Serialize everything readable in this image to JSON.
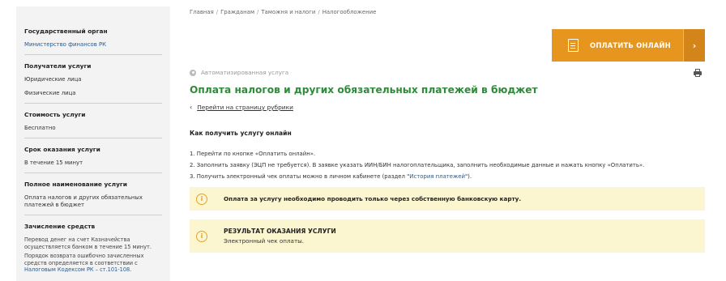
{
  "sidebar": {
    "agency": {
      "heading": "Государственный орган",
      "value": "Министерство финансов РК"
    },
    "recipients": {
      "heading": "Получатели услуги",
      "items": [
        "Юридические лица",
        "Физические лица"
      ]
    },
    "cost": {
      "heading": "Стоимость услуги",
      "value": "Бесплатно"
    },
    "duration": {
      "heading": "Срок оказания услуги",
      "value": "В течение 15 минут"
    },
    "full_name": {
      "heading": "Полное наименование услуги",
      "line1": "Оплата налогов и других обязательных",
      "line2": "платежей в бюджет"
    },
    "crediting": {
      "heading": "Зачисление средств",
      "p1_line1": "Перевод  денег на счет Казначейства",
      "p1_line2": "осуществляется банком в течение  15 минут.",
      "p2_line1": "Порядок возврата ошибочно зачисленных",
      "p2_line2": "средств определяется в соответствии с",
      "p2_link": "Налоговым Кодексом РК – ст.101-108",
      "p2_end": "."
    }
  },
  "breadcrumb": [
    "Главная",
    "Гражданам",
    "Таможня и налоги",
    "Налогообложение"
  ],
  "pay_button": {
    "label": "ОПЛАТИТЬ ОНЛАЙН",
    "arrow": "›"
  },
  "service_type": "Автоматизированная услуга",
  "page_title": "Оплата налогов и других обязательных платежей в бюджет",
  "back_link": {
    "chevron": "‹",
    "label": "Перейти на страницу рубрики"
  },
  "howto": {
    "heading": "Как получить услугу онлайн",
    "step1": "1. Перейти по кнопке «Оплатить онлайн».",
    "step2": "2. Заполнить  заявку (ЭЦП не требуется). В заявке указать ИИН/БИН налогоплательщика, заполнить необходимые данные и нажать кнопку «Оплатить».",
    "step3_pre": "3. Получить электронный чек оплаты можно в личном кабинете (раздел \"",
    "step3_link": "История платежей",
    "step3_post": "\")."
  },
  "notice": {
    "text": "Оплата за услугу необходимо проводить только через собственную банковскую карту."
  },
  "result": {
    "heading": "РЕЗУЛЬТАТ ОКАЗАНИЯ УСЛУГИ",
    "text": "Электронный чек оплаты."
  },
  "icons": {
    "info_glyph": "i"
  },
  "colors": {
    "accent_green": "#2f8a3a",
    "pay_orange": "#e6951f",
    "notice_bg": "#fbf6cf",
    "link_blue": "#2a5a8a"
  }
}
